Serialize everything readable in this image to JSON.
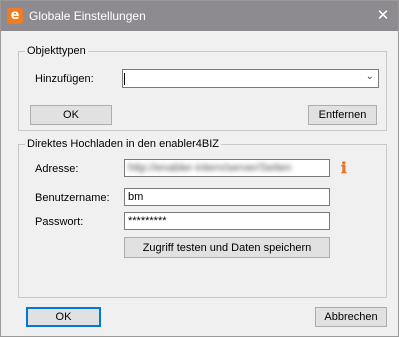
{
  "window": {
    "title": "Globale Einstellungen",
    "app_icon_glyph": "e",
    "close_glyph": "✕",
    "accent_color": "#ef7c22"
  },
  "objekttypen": {
    "legend": "Objekttypen",
    "add_label": "Hinzufügen:",
    "add_value": "",
    "ok_label": "OK",
    "remove_label": "Entfernen"
  },
  "upload": {
    "legend": "Direktes Hochladen in den enabler4BIZ",
    "address_label": "Adresse:",
    "address_value": "http://enabler-intern/server/Seiten",
    "username_label": "Benutzername:",
    "username_value": "bm",
    "password_label": "Passwort:",
    "password_value": "*********",
    "test_button_label": "Zugriff testen und Daten speichern",
    "info_glyph": "ℹ"
  },
  "footer": {
    "ok_label": "OK",
    "cancel_label": "Abbrechen"
  }
}
